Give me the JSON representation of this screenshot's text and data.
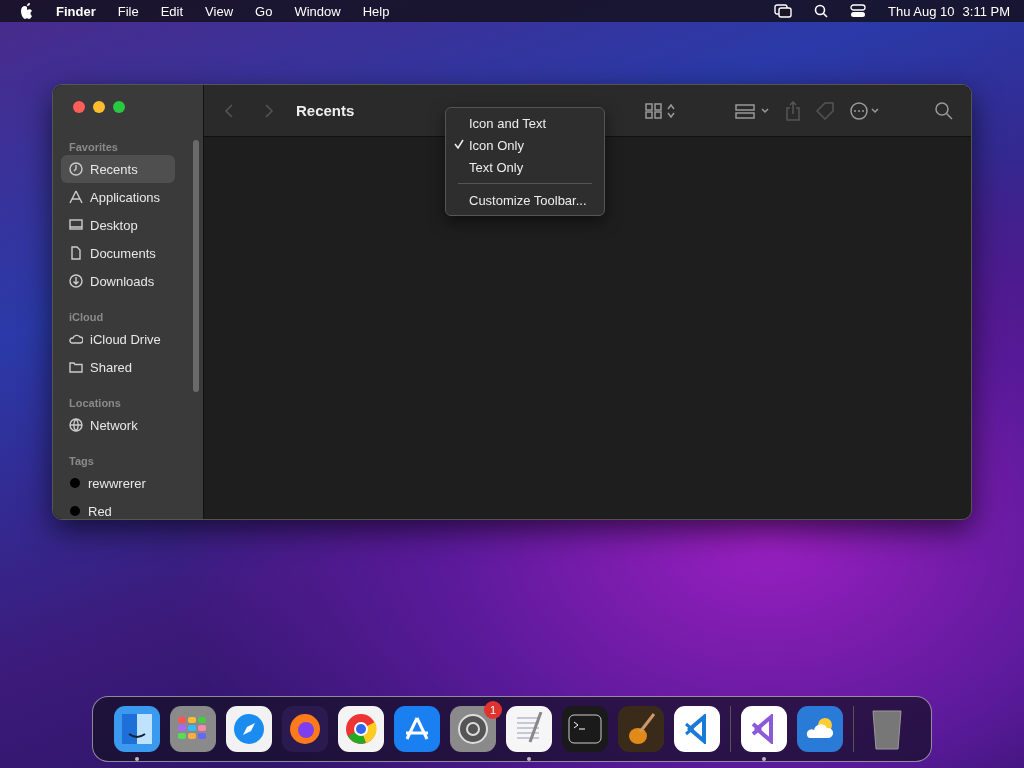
{
  "menu_bar": {
    "app": "Finder",
    "menus": [
      "File",
      "Edit",
      "View",
      "Go",
      "Window",
      "Help"
    ],
    "date": "Thu Aug 10",
    "time": "3:11 PM"
  },
  "window": {
    "title": "Recents",
    "sidebar": {
      "sections": [
        {
          "heading": "Favorites",
          "items": [
            {
              "label": "Recents",
              "kind": "clock",
              "selected": true
            },
            {
              "label": "Applications",
              "kind": "apps",
              "selected": false
            },
            {
              "label": "Desktop",
              "kind": "desktop",
              "selected": false
            },
            {
              "label": "Documents",
              "kind": "doc",
              "selected": false
            },
            {
              "label": "Downloads",
              "kind": "download",
              "selected": false
            }
          ]
        },
        {
          "heading": "iCloud",
          "items": [
            {
              "label": "iCloud Drive",
              "kind": "cloud",
              "selected": false
            },
            {
              "label": "Shared",
              "kind": "folder",
              "selected": false
            }
          ]
        },
        {
          "heading": "Locations",
          "items": [
            {
              "label": "Network",
              "kind": "globe",
              "selected": false
            }
          ]
        },
        {
          "heading": "Tags",
          "items": [
            {
              "label": "rewwrerer",
              "kind": "tag",
              "color": "#000000",
              "selected": false
            },
            {
              "label": "Red",
              "kind": "tag",
              "color": "#000000",
              "selected": false
            }
          ]
        }
      ]
    },
    "context_menu": {
      "items": [
        {
          "kind": "option",
          "label": "Icon and Text",
          "checked": false
        },
        {
          "kind": "option",
          "label": "Icon Only",
          "checked": true
        },
        {
          "kind": "option",
          "label": "Text Only",
          "checked": false
        },
        {
          "kind": "separator"
        },
        {
          "kind": "option",
          "label": "Customize Toolbar...",
          "checked": false
        }
      ]
    }
  },
  "dock": {
    "apps": [
      {
        "kind": "finder",
        "running": true
      },
      {
        "kind": "launchpad",
        "running": false
      },
      {
        "kind": "safari",
        "running": false
      },
      {
        "kind": "firefox",
        "running": false
      },
      {
        "kind": "chrome",
        "running": false
      },
      {
        "kind": "appstore",
        "running": false
      },
      {
        "kind": "settings",
        "running": false,
        "badge": "1"
      },
      {
        "kind": "textedit",
        "running": true
      },
      {
        "kind": "terminal",
        "running": false
      },
      {
        "kind": "garageband",
        "running": false
      },
      {
        "kind": "vscode",
        "running": false
      },
      {
        "kind": "divider"
      },
      {
        "kind": "visualstudio",
        "running": true
      },
      {
        "kind": "weather",
        "running": false
      },
      {
        "kind": "divider"
      },
      {
        "kind": "trash",
        "running": false
      }
    ]
  }
}
